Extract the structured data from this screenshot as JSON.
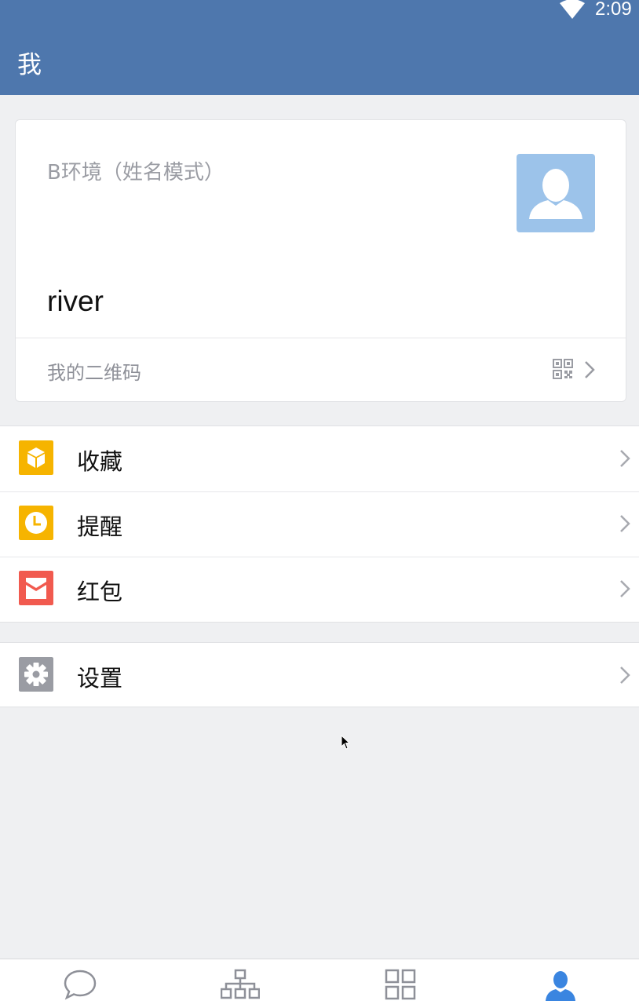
{
  "status_bar": {
    "time": "2:09",
    "wifi_icon": "wifi-icon"
  },
  "app_bar": {
    "title": "我"
  },
  "profile_card": {
    "org_name": "B环境（姓名模式）",
    "user_name": "river",
    "avatar_icon": "person-icon",
    "qr_row": {
      "label": "我的二维码",
      "qr_icon": "qr-code-icon",
      "chevron_icon": "chevron-right-icon"
    }
  },
  "menu": {
    "group1": [
      {
        "label": "收藏",
        "icon": "favorites-box-icon",
        "color": "#f6b400"
      },
      {
        "label": "提醒",
        "icon": "clock-icon",
        "color": "#f6b400"
      },
      {
        "label": "红包",
        "icon": "red-envelope-icon",
        "color": "#f15a4f"
      }
    ],
    "group2": [
      {
        "label": "设置",
        "icon": "gear-icon",
        "color": "#9a9ca3"
      }
    ]
  },
  "tabbar": {
    "tabs": [
      {
        "label": "",
        "icon": "chat-bubble-icon",
        "active": false
      },
      {
        "label": "",
        "icon": "org-chart-icon",
        "active": false
      },
      {
        "label": "",
        "icon": "apps-grid-icon",
        "active": false
      },
      {
        "label": "",
        "icon": "person-icon",
        "active": true
      }
    ],
    "active_color": "#3a85e0",
    "inactive_color": "#8e9098"
  },
  "theme": {
    "app_bar_color": "#4e77ad",
    "background": "#eff0f2",
    "avatar_bg": "#9cc3ea"
  }
}
